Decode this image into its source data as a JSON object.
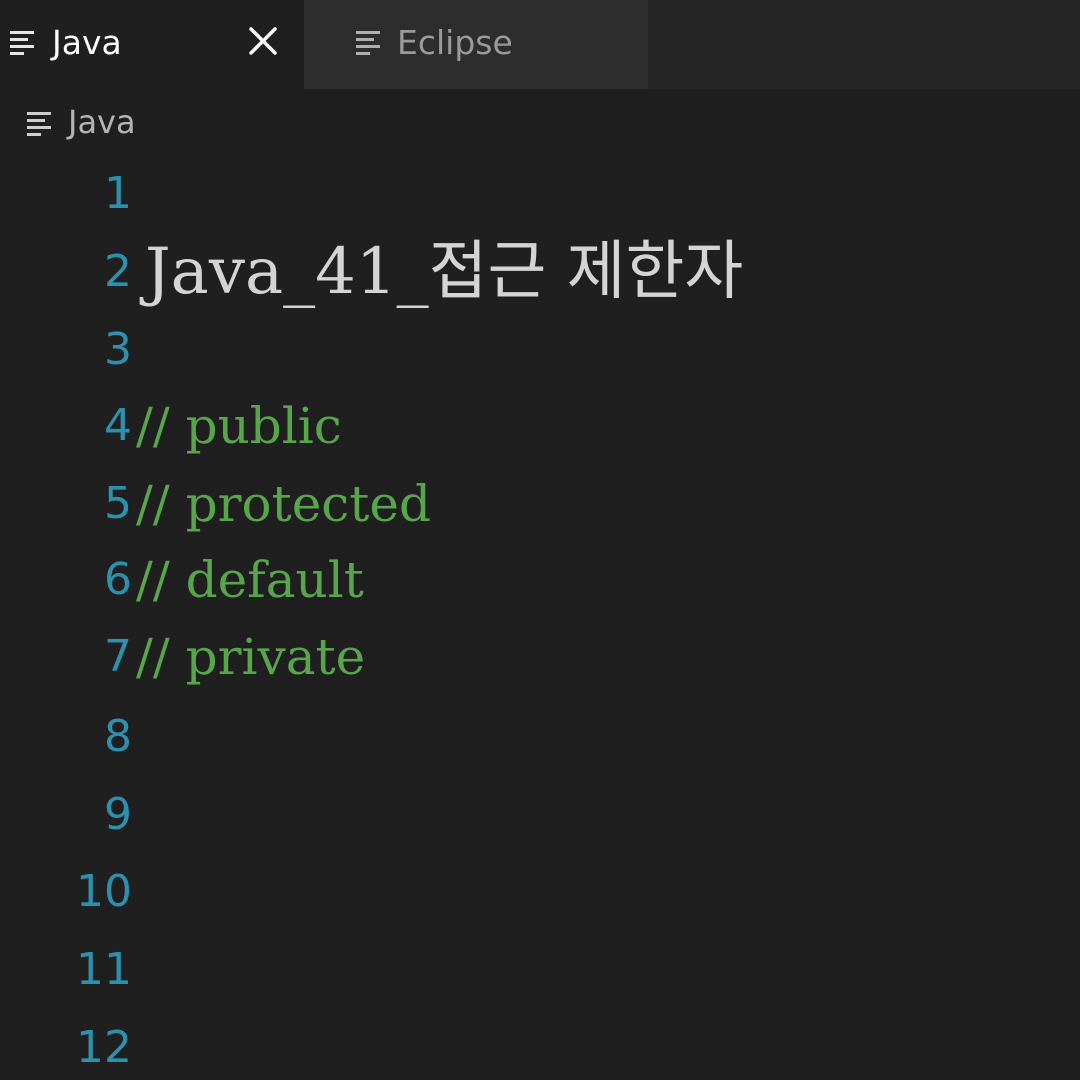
{
  "tabs": [
    {
      "label": "Java",
      "active": true,
      "icon": "text-lines-icon",
      "close_icon": "close-icon"
    },
    {
      "label": "Eclipse",
      "active": false,
      "icon": "text-lines-icon"
    }
  ],
  "breadcrumb": {
    "label": "Java",
    "icon": "text-lines-icon"
  },
  "editor": {
    "lines": [
      {
        "number": "1",
        "text": ""
      },
      {
        "number": "2",
        "text": "Java_41_접근 제한자"
      },
      {
        "number": "3",
        "text": ""
      },
      {
        "number": "4",
        "text": "// public"
      },
      {
        "number": "5",
        "text": "// protected"
      },
      {
        "number": "6",
        "text": "// default"
      },
      {
        "number": "7",
        "text": "// private"
      },
      {
        "number": "8",
        "text": ""
      },
      {
        "number": "9",
        "text": ""
      },
      {
        "number": "10",
        "text": ""
      },
      {
        "number": "11",
        "text": ""
      },
      {
        "number": "12",
        "text": ""
      }
    ]
  },
  "colors": {
    "background": "#1f1f1f",
    "tabbar": "#252526",
    "inactive_tab": "#2d2d2d",
    "line_number": "#2b91af",
    "comment": "#57a64a",
    "title_text": "#d4d4d4"
  }
}
